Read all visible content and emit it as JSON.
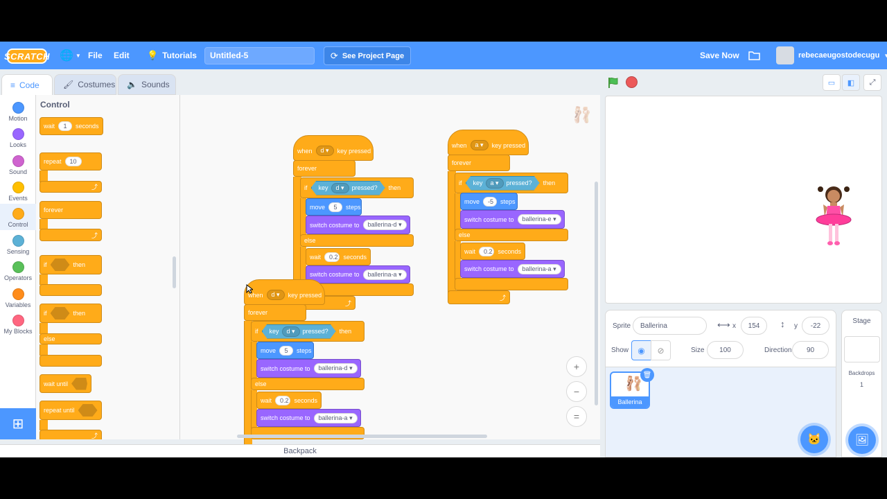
{
  "menubar": {
    "logo": "SCRATCH",
    "file": "File",
    "edit": "Edit",
    "tutorials": "Tutorials",
    "project_title": "Untitled-5",
    "see_project_page": "See Project Page",
    "save_now": "Save Now",
    "username": "rebecaeugostodecugu"
  },
  "tabs": {
    "code": "Code",
    "costumes": "Costumes",
    "sounds": "Sounds"
  },
  "categories": [
    "Motion",
    "Looks",
    "Sound",
    "Events",
    "Control",
    "Sensing",
    "Operators",
    "Variables",
    "My Blocks"
  ],
  "category_colors": [
    "#4c97ff",
    "#9966ff",
    "#cf63cf",
    "#ffbf00",
    "#ffab19",
    "#5cb1d6",
    "#59c059",
    "#ff8c1a",
    "#ff6680"
  ],
  "palette": {
    "heading": "Control",
    "wait": "wait",
    "wait_val": "1",
    "seconds": "seconds",
    "repeat": "repeat",
    "repeat_val": "10",
    "forever": "forever",
    "if": "if",
    "then": "then",
    "else": "else",
    "wait_until": "wait until",
    "repeat_until": "repeat until"
  },
  "scripts": {
    "when": "when",
    "key_pressed": "key pressed",
    "forever": "forever",
    "if": "if",
    "then": "then",
    "else": "else",
    "key": "key",
    "pressed_q": "pressed?",
    "move": "move",
    "steps": "steps",
    "switch_costume": "switch costume to",
    "wait": "wait",
    "seconds": "seconds",
    "s1": {
      "key": "d",
      "move": "5",
      "costume_if": "ballerina-d",
      "wait": "0.2",
      "costume_else": "ballerina-a"
    },
    "s2": {
      "key": "a",
      "move": "-5",
      "costume_if": "ballerina-e",
      "wait": "0.2",
      "costume_else": "ballerina-a"
    },
    "s3": {
      "key": "d",
      "move": "5",
      "costume_if": "ballerina-d",
      "wait": "0.2",
      "costume_else": "ballerina-a"
    },
    "backpack": "Backpack"
  },
  "zoom": {
    "in": "+",
    "out": "−",
    "reset": "="
  },
  "sprite_info": {
    "sprite_label": "Sprite",
    "sprite_name": "Ballerina",
    "x_label": "x",
    "x_value": "154",
    "y_label": "y",
    "y_value": "-22",
    "show_label": "Show",
    "size_label": "Size",
    "size_value": "100",
    "direction_label": "Direction",
    "direction_value": "90"
  },
  "sprite_list": [
    {
      "name": "Ballerina"
    }
  ],
  "stage_col": {
    "title": "Stage",
    "backdrops_label": "Backdrops",
    "backdrops_count": "1"
  }
}
